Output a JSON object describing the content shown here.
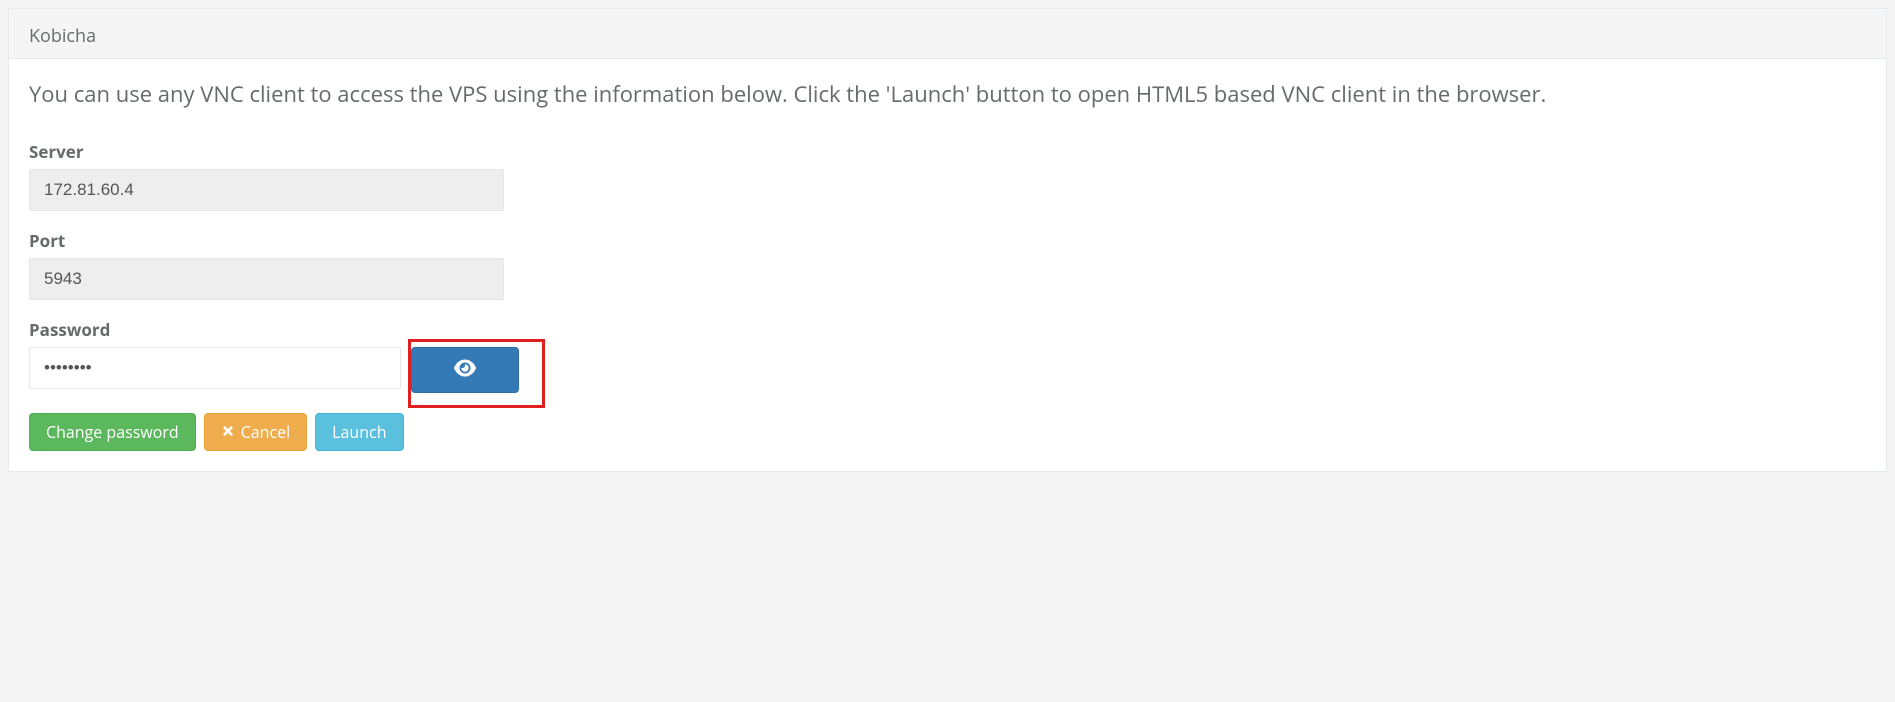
{
  "panel": {
    "title": "Kobicha"
  },
  "description": "You can use any VNC client to access the VPS using the information below. Click the 'Launch' button to open HTML5 based VNC client in the browser.",
  "form": {
    "server": {
      "label": "Server",
      "value": "172.81.60.4"
    },
    "port": {
      "label": "Port",
      "value": "5943"
    },
    "password": {
      "label": "Password",
      "value": "••••••••"
    }
  },
  "buttons": {
    "change_password": "Change password",
    "cancel": "Cancel",
    "launch": "Launch"
  }
}
